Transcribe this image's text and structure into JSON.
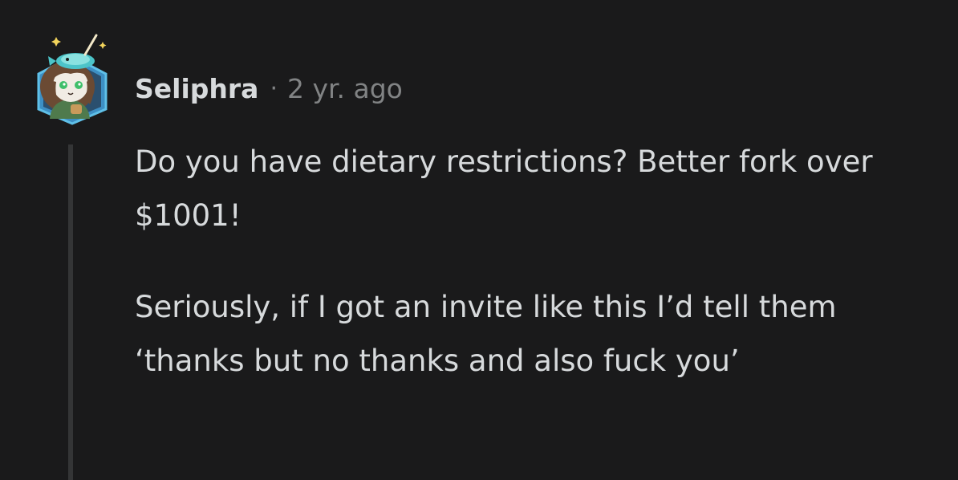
{
  "comment": {
    "username": "Seliphra",
    "separator": "·",
    "timestamp": "2 yr. ago",
    "paragraphs": [
      "Do you have dietary restrictions? Better fork over $1001!",
      "Seriously, if I got an invite like this I’d tell them ‘thanks but no thanks and also fuck you’"
    ]
  },
  "colors": {
    "background": "#1a1a1b",
    "text": "#d7dadc",
    "meta": "#818384",
    "thread_line": "#343536"
  },
  "icons": {
    "avatar": "snoo-avatar-with-narwhal-hat"
  }
}
